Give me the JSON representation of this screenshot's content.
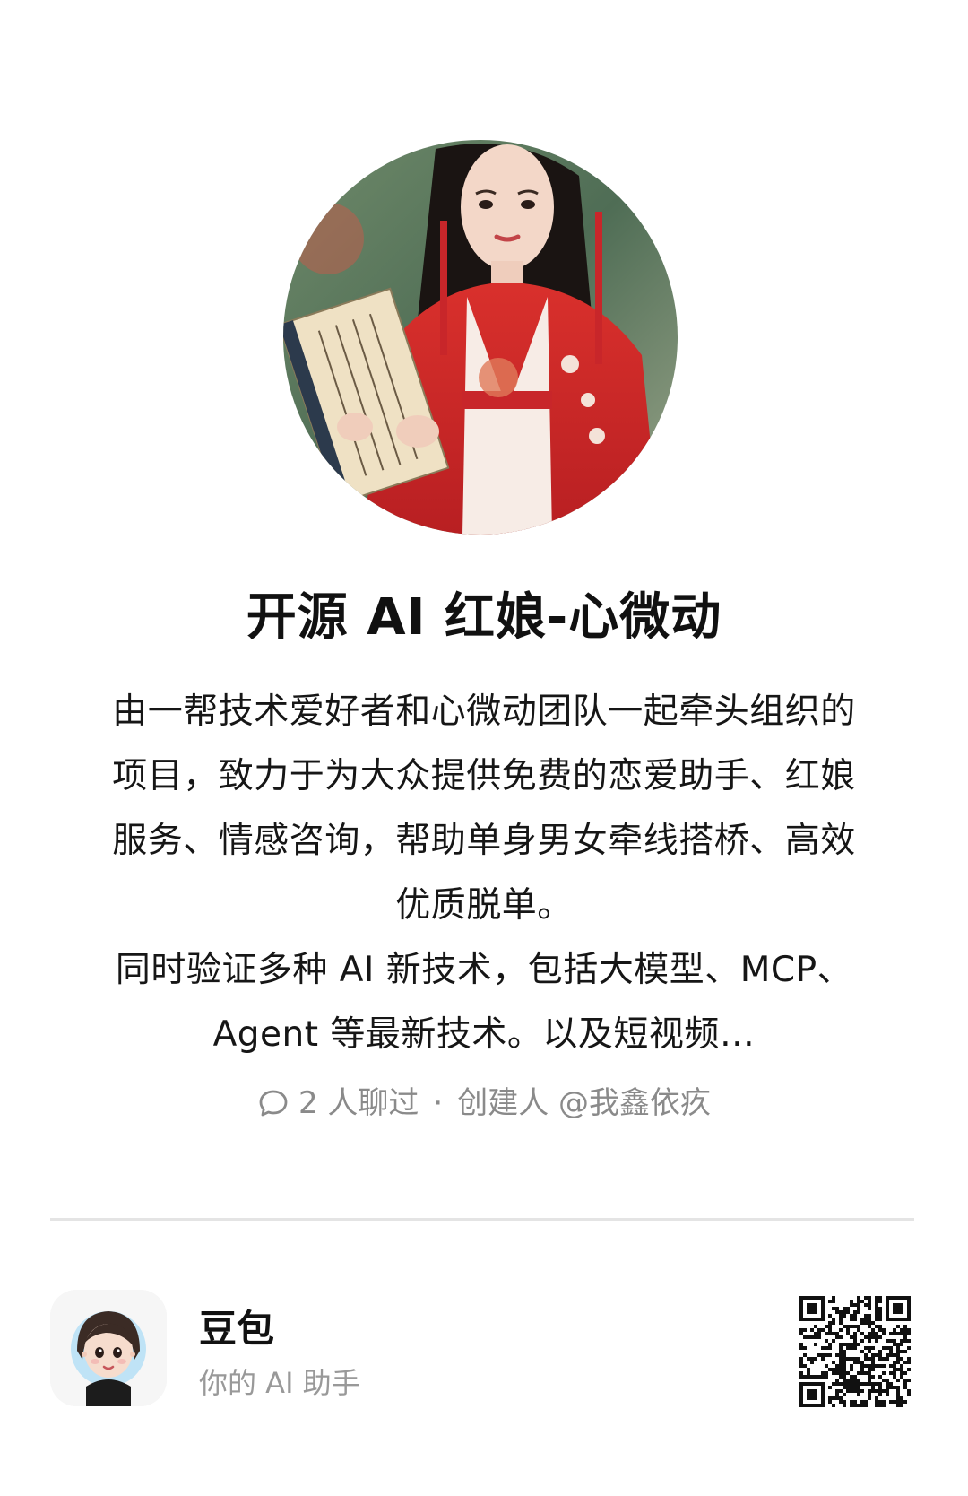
{
  "bot": {
    "avatar_icon": "hanfu-girl-avatar",
    "title": "开源 AI 红娘-心微动",
    "description": "由一帮技术爱好者和心微动团队一起牵头组织的项目，致力于为大众提供免费的恋爱助手、红娘服务、情感咨询，帮助单身男女牵线搭桥、高效优质脱单。\n同时验证多种 AI 新技术，包括大模型、MCP、Agent 等最新技术。以及短视频…"
  },
  "meta": {
    "chat_icon": "chat-bubble-icon",
    "chat_count": "2 人聊过",
    "separator": "·",
    "creator": "创建人 @我鑫依疚"
  },
  "footer": {
    "app_icon": "doubao-avatar-icon",
    "app_name": "豆包",
    "tagline": "你的 AI 助手",
    "qr_icon": "qr-code-icon"
  },
  "colors": {
    "accent_red": "#c8262a",
    "meta_gray": "#8a8a8a",
    "divider": "#e4e4e4"
  }
}
